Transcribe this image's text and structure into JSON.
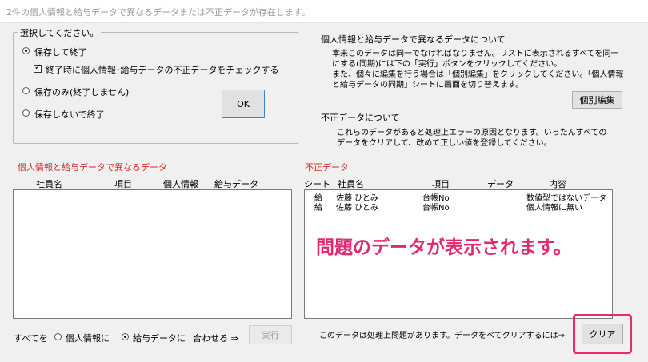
{
  "window": {
    "title": "2件の個人情報と給与データで異なるデータまたは不正データが存在します。"
  },
  "select_group": {
    "label": "選択してください。",
    "options": [
      {
        "label": "保存して終了",
        "selected": true
      },
      {
        "label": "保存のみ(終了しません)",
        "selected": false
      },
      {
        "label": "保存しないで終了",
        "selected": false
      }
    ],
    "check_label": "終了時に個人情報･給与データの不正データをチェックする",
    "ok_label": "OK"
  },
  "info": {
    "diff_heading": "個人情報と給与データで異なるデータについて",
    "diff_lines": [
      "本来このデータは同一でなければなりません。リストに表示されるすべてを同一",
      "にする(同期)には下の「実行」ボタンをクリックしてください。",
      "また、個々に編集を行う場合は「個別編集」をクリックしてください。「個人情報",
      "と給与データの同期」シートに画面を切り替えます。"
    ],
    "individual_edit_label": "個別編集",
    "invalid_heading": "不正データについて",
    "invalid_lines": [
      "これらのデータがあると処理上エラーの原因となります。いったんすべての",
      "データをクリアして、改めて正しい値を登録してください。"
    ]
  },
  "diff_list": {
    "title": "個人情報と給与データで異なるデータ",
    "columns": [
      "社員名",
      "項目",
      "個人情報",
      "給与データ"
    ]
  },
  "invalid_list": {
    "title": "不正データ",
    "columns": [
      "シート",
      "社員名",
      "項目",
      "データ",
      "内容"
    ],
    "rows": [
      {
        "sheet": "給",
        "name": "佐藤 ひとみ",
        "item": "台帳No",
        "data": "",
        "content": "数値型ではないデータ"
      },
      {
        "sheet": "給",
        "name": "佐藤 ひとみ",
        "item": "台帳No",
        "data": "",
        "content": "個人情報に無い"
      }
    ]
  },
  "bottom": {
    "all_label": "すべてを",
    "align_options": [
      {
        "label": "個人情報に",
        "selected": false
      },
      {
        "label": "給与データに",
        "selected": true
      }
    ],
    "match_label": "合わせる ⇒",
    "execute_label": "実行",
    "clear_hint": "このデータは処理上問題があります。データをべてクリアするには⇒",
    "clear_label": "クリア"
  },
  "annotation": {
    "text": "問題のデータが表示されます。"
  },
  "colors": {
    "accent_red": "#d42a2a",
    "callout_pink": "#e0296f",
    "highlight_pink": "#ec2a6a"
  }
}
